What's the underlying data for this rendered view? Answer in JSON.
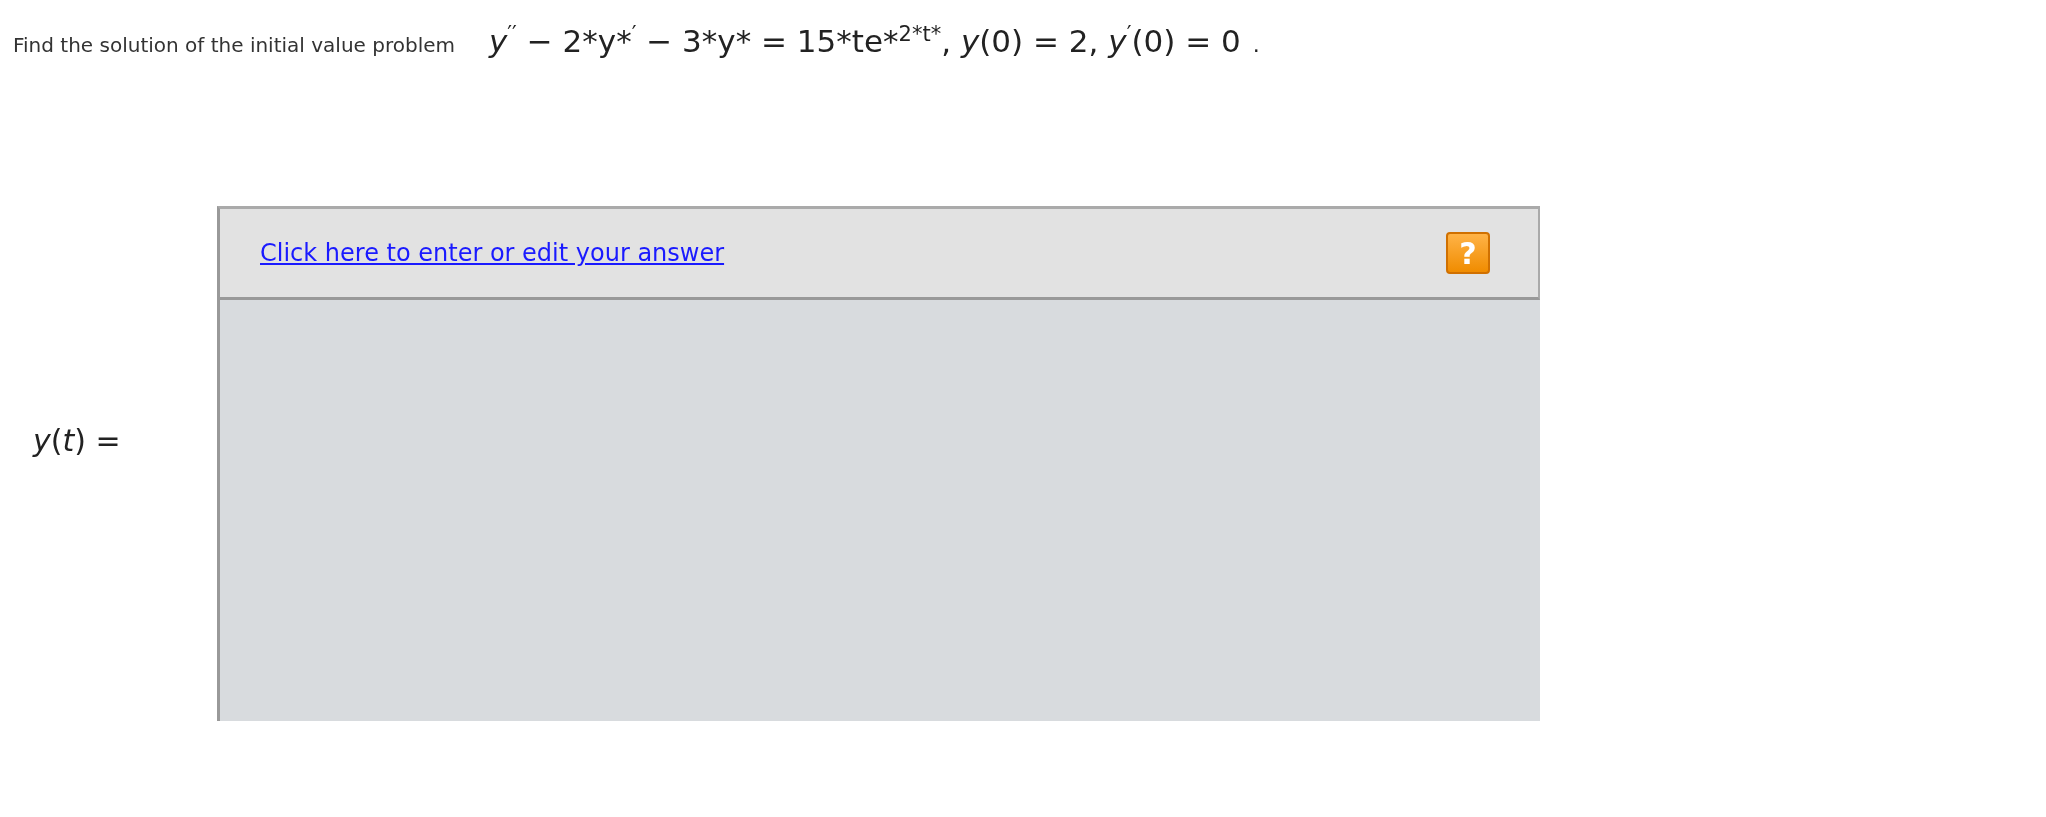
{
  "question": {
    "prompt": "Find the solution of the initial value problem",
    "equation": "*y*$^{′′}$ − 2*y*$^{′}$ − 3*y* = 15*te*$^{2*t*}$,  *y*(0) = 2,  *y*$^{′}$(0) = 0",
    "end_mark": "."
  },
  "answer": {
    "label": "*y*(*t*) =",
    "link": "Click here to enter or edit your answer",
    "help": "?"
  }
}
